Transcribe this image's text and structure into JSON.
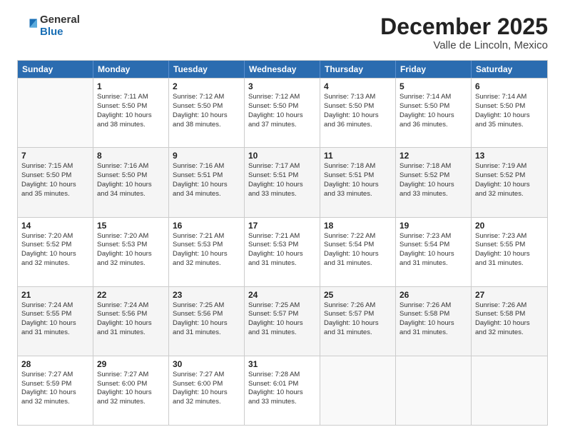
{
  "logo": {
    "general": "General",
    "blue": "Blue"
  },
  "header": {
    "title": "December 2025",
    "subtitle": "Valle de Lincoln, Mexico"
  },
  "days_of_week": [
    "Sunday",
    "Monday",
    "Tuesday",
    "Wednesday",
    "Thursday",
    "Friday",
    "Saturday"
  ],
  "weeks": [
    [
      {
        "day": "",
        "lines": []
      },
      {
        "day": "1",
        "lines": [
          "Sunrise: 7:11 AM",
          "Sunset: 5:50 PM",
          "Daylight: 10 hours",
          "and 38 minutes."
        ]
      },
      {
        "day": "2",
        "lines": [
          "Sunrise: 7:12 AM",
          "Sunset: 5:50 PM",
          "Daylight: 10 hours",
          "and 38 minutes."
        ]
      },
      {
        "day": "3",
        "lines": [
          "Sunrise: 7:12 AM",
          "Sunset: 5:50 PM",
          "Daylight: 10 hours",
          "and 37 minutes."
        ]
      },
      {
        "day": "4",
        "lines": [
          "Sunrise: 7:13 AM",
          "Sunset: 5:50 PM",
          "Daylight: 10 hours",
          "and 36 minutes."
        ]
      },
      {
        "day": "5",
        "lines": [
          "Sunrise: 7:14 AM",
          "Sunset: 5:50 PM",
          "Daylight: 10 hours",
          "and 36 minutes."
        ]
      },
      {
        "day": "6",
        "lines": [
          "Sunrise: 7:14 AM",
          "Sunset: 5:50 PM",
          "Daylight: 10 hours",
          "and 35 minutes."
        ]
      }
    ],
    [
      {
        "day": "7",
        "lines": [
          "Sunrise: 7:15 AM",
          "Sunset: 5:50 PM",
          "Daylight: 10 hours",
          "and 35 minutes."
        ]
      },
      {
        "day": "8",
        "lines": [
          "Sunrise: 7:16 AM",
          "Sunset: 5:50 PM",
          "Daylight: 10 hours",
          "and 34 minutes."
        ]
      },
      {
        "day": "9",
        "lines": [
          "Sunrise: 7:16 AM",
          "Sunset: 5:51 PM",
          "Daylight: 10 hours",
          "and 34 minutes."
        ]
      },
      {
        "day": "10",
        "lines": [
          "Sunrise: 7:17 AM",
          "Sunset: 5:51 PM",
          "Daylight: 10 hours",
          "and 33 minutes."
        ]
      },
      {
        "day": "11",
        "lines": [
          "Sunrise: 7:18 AM",
          "Sunset: 5:51 PM",
          "Daylight: 10 hours",
          "and 33 minutes."
        ]
      },
      {
        "day": "12",
        "lines": [
          "Sunrise: 7:18 AM",
          "Sunset: 5:52 PM",
          "Daylight: 10 hours",
          "and 33 minutes."
        ]
      },
      {
        "day": "13",
        "lines": [
          "Sunrise: 7:19 AM",
          "Sunset: 5:52 PM",
          "Daylight: 10 hours",
          "and 32 minutes."
        ]
      }
    ],
    [
      {
        "day": "14",
        "lines": [
          "Sunrise: 7:20 AM",
          "Sunset: 5:52 PM",
          "Daylight: 10 hours",
          "and 32 minutes."
        ]
      },
      {
        "day": "15",
        "lines": [
          "Sunrise: 7:20 AM",
          "Sunset: 5:53 PM",
          "Daylight: 10 hours",
          "and 32 minutes."
        ]
      },
      {
        "day": "16",
        "lines": [
          "Sunrise: 7:21 AM",
          "Sunset: 5:53 PM",
          "Daylight: 10 hours",
          "and 32 minutes."
        ]
      },
      {
        "day": "17",
        "lines": [
          "Sunrise: 7:21 AM",
          "Sunset: 5:53 PM",
          "Daylight: 10 hours",
          "and 31 minutes."
        ]
      },
      {
        "day": "18",
        "lines": [
          "Sunrise: 7:22 AM",
          "Sunset: 5:54 PM",
          "Daylight: 10 hours",
          "and 31 minutes."
        ]
      },
      {
        "day": "19",
        "lines": [
          "Sunrise: 7:23 AM",
          "Sunset: 5:54 PM",
          "Daylight: 10 hours",
          "and 31 minutes."
        ]
      },
      {
        "day": "20",
        "lines": [
          "Sunrise: 7:23 AM",
          "Sunset: 5:55 PM",
          "Daylight: 10 hours",
          "and 31 minutes."
        ]
      }
    ],
    [
      {
        "day": "21",
        "lines": [
          "Sunrise: 7:24 AM",
          "Sunset: 5:55 PM",
          "Daylight: 10 hours",
          "and 31 minutes."
        ]
      },
      {
        "day": "22",
        "lines": [
          "Sunrise: 7:24 AM",
          "Sunset: 5:56 PM",
          "Daylight: 10 hours",
          "and 31 minutes."
        ]
      },
      {
        "day": "23",
        "lines": [
          "Sunrise: 7:25 AM",
          "Sunset: 5:56 PM",
          "Daylight: 10 hours",
          "and 31 minutes."
        ]
      },
      {
        "day": "24",
        "lines": [
          "Sunrise: 7:25 AM",
          "Sunset: 5:57 PM",
          "Daylight: 10 hours",
          "and 31 minutes."
        ]
      },
      {
        "day": "25",
        "lines": [
          "Sunrise: 7:26 AM",
          "Sunset: 5:57 PM",
          "Daylight: 10 hours",
          "and 31 minutes."
        ]
      },
      {
        "day": "26",
        "lines": [
          "Sunrise: 7:26 AM",
          "Sunset: 5:58 PM",
          "Daylight: 10 hours",
          "and 31 minutes."
        ]
      },
      {
        "day": "27",
        "lines": [
          "Sunrise: 7:26 AM",
          "Sunset: 5:58 PM",
          "Daylight: 10 hours",
          "and 32 minutes."
        ]
      }
    ],
    [
      {
        "day": "28",
        "lines": [
          "Sunrise: 7:27 AM",
          "Sunset: 5:59 PM",
          "Daylight: 10 hours",
          "and 32 minutes."
        ]
      },
      {
        "day": "29",
        "lines": [
          "Sunrise: 7:27 AM",
          "Sunset: 6:00 PM",
          "Daylight: 10 hours",
          "and 32 minutes."
        ]
      },
      {
        "day": "30",
        "lines": [
          "Sunrise: 7:27 AM",
          "Sunset: 6:00 PM",
          "Daylight: 10 hours",
          "and 32 minutes."
        ]
      },
      {
        "day": "31",
        "lines": [
          "Sunrise: 7:28 AM",
          "Sunset: 6:01 PM",
          "Daylight: 10 hours",
          "and 33 minutes."
        ]
      },
      {
        "day": "",
        "lines": []
      },
      {
        "day": "",
        "lines": []
      },
      {
        "day": "",
        "lines": []
      }
    ]
  ]
}
